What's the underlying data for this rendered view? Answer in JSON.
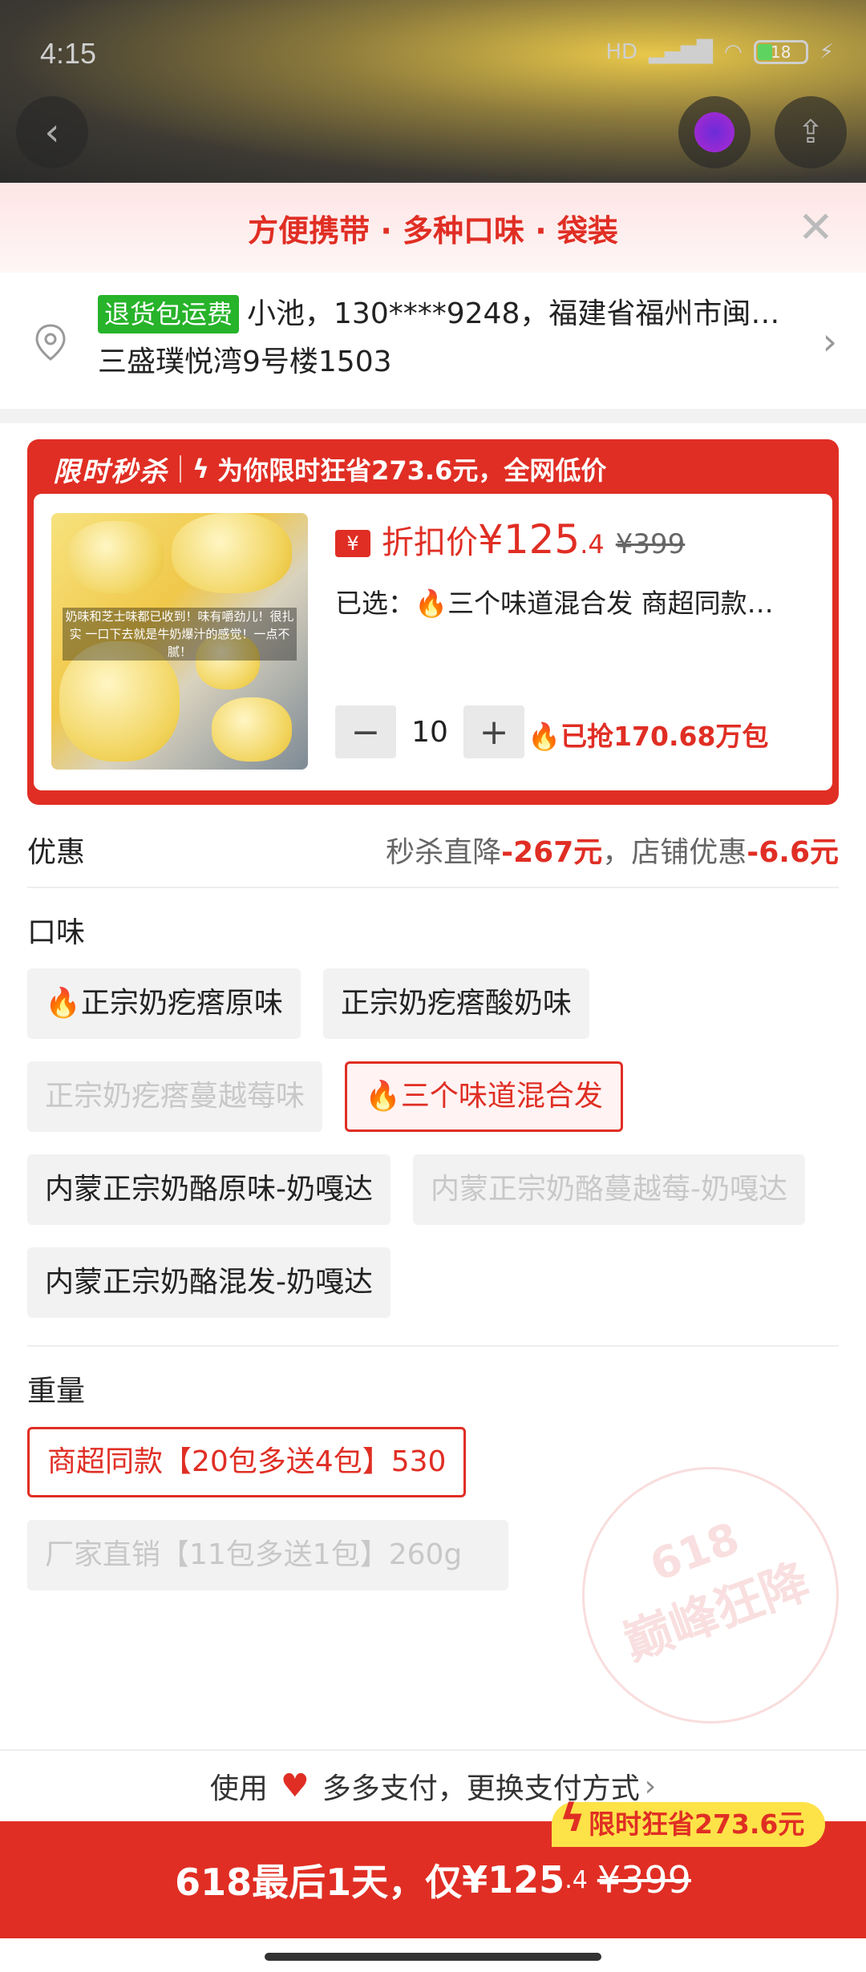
{
  "status": {
    "time": "4:15",
    "signal": "HD",
    "battery": "18"
  },
  "nav": {
    "back_icon": "back-arrow-icon",
    "share_icon": "share-icon"
  },
  "promo_header": {
    "text": "方便携带 · 多种口味 · 袋装"
  },
  "address": {
    "badge": "退货包运费",
    "line1": "小池，130****9248，福建省福州市闽…",
    "line2": "三盛璞悦湾9号楼1503"
  },
  "flash_sale": {
    "tag": "限时秒杀",
    "headline": "为你限时狂省273.6元，全网低价",
    "ticket": "¥",
    "price_label": "折扣价",
    "price_currency": "¥",
    "price_int": "125",
    "price_dec": ".4",
    "original_price": "¥399",
    "selected_label": "已选：",
    "selected_value": "三个味道混合发 商超同款…",
    "quantity": "10",
    "grabbed": "已抢170.68万包",
    "image_caption": "奶味和芝士味都已收到！味有嚼劲儿！很扎实 一口下去就是牛奶爆汁的感觉！一点不腻！"
  },
  "discount": {
    "label": "优惠",
    "seckill_label": "秒杀直降",
    "seckill_value": "-267元",
    "shop_label": "，店铺优惠",
    "shop_value": "-6.6元"
  },
  "flavor": {
    "title": "口味",
    "options": [
      {
        "label": "正宗奶疙瘩原味",
        "state": "normal",
        "hot": true
      },
      {
        "label": "正宗奶疙瘩酸奶味",
        "state": "normal",
        "hot": false
      },
      {
        "label": "正宗奶疙瘩蔓越莓味",
        "state": "disabled",
        "hot": false
      },
      {
        "label": "三个味道混合发",
        "state": "selected",
        "hot": true
      },
      {
        "label": "内蒙正宗奶酪原味-奶嘎达",
        "state": "normal",
        "hot": false
      },
      {
        "label": "内蒙正宗奶酪蔓越莓-奶嘎达",
        "state": "disabled",
        "hot": false
      },
      {
        "label": "内蒙正宗奶酪混发-奶嘎达",
        "state": "normal",
        "hot": false
      }
    ]
  },
  "weight": {
    "title": "重量",
    "options": [
      {
        "label": "商超同款【20包多送4包】530",
        "state": "selected"
      },
      {
        "label": "厂家直销【11包多送1包】260g",
        "state": "disabled"
      }
    ]
  },
  "stamp": {
    "line1": "618",
    "line2": "巅峰狂降"
  },
  "payment": {
    "prefix": "使用",
    "method": "多多支付，更换支付方式",
    "icon": "heart-shield-icon"
  },
  "limit_badge": {
    "text": "限时狂省273.6元"
  },
  "buy_button": {
    "prefix": "618最后1天，仅 ",
    "currency": "¥",
    "price_int": "125",
    "price_dec": ".4",
    "original": "¥399"
  },
  "colors": {
    "accent": "#e02e24",
    "green_badge": "#27b32a",
    "yellow_badge": "#fde248"
  }
}
